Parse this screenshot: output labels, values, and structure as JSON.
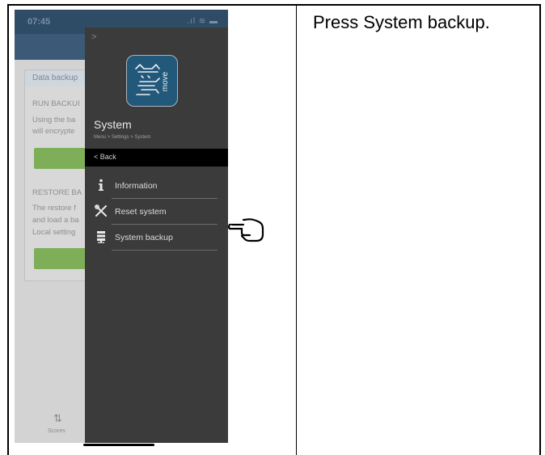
{
  "instruction": "Press System backup.",
  "status_bar": {
    "time": "07:45",
    "icons": ".ıl ≋ ▬"
  },
  "background": {
    "card_title": "Data backup",
    "run_heading": "RUN BACKUI",
    "run_line1": "Using the ba",
    "run_line2": "will encrypte",
    "restore_heading": "RESTORE BA",
    "restore_line1": "The restore f",
    "restore_line2": "and load a ba",
    "restore_line3": "Local setting",
    "tab_label": "Scores"
  },
  "drawer": {
    "logo_text": "move",
    "title": "System",
    "breadcrumb": "Menu > Settings > System",
    "back_label": "Back",
    "items": [
      {
        "label": "Information",
        "icon": "info-icon"
      },
      {
        "label": "Reset system",
        "icon": "tools-icon"
      },
      {
        "label": "System backup",
        "icon": "server-icon"
      }
    ]
  },
  "pointer_icon": "pointing-hand-icon"
}
